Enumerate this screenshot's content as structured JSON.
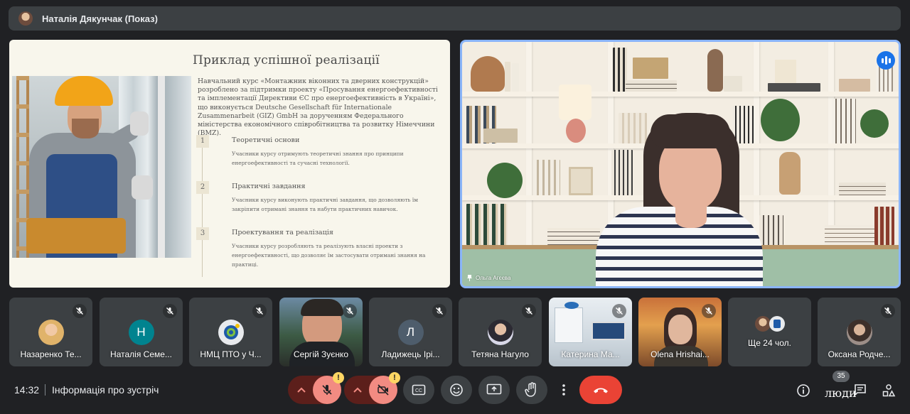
{
  "presenter": {
    "name": "Наталія Дякунчак (Показ)"
  },
  "slide": {
    "title": "Приклад успішної реалізації",
    "intro": "Навчальний курс «Монтажник віконних та дверних конструкцій» розроблено за підтримки проекту «Просування енергоефективності та імплементації Директиви ЄС про енергоефективність в Україні», що виконується Deutsche Gesellschaft für Internationale Zusammenarbeit (GIZ) GmbH за дорученням Федерального міністерства економічного співробітництва та розвитку Німеччини (BMZ).",
    "steps": [
      {
        "num": "1",
        "title": "Теоретичні основи",
        "desc": "Учасники курсу отримують теоретичні знання про принципи енергоефективності та сучасні технології."
      },
      {
        "num": "2",
        "title": "Практичні завдання",
        "desc": "Учасники курсу виконують практичні завдання, що дозволяють їм закріпити отримані знання та набути практичних навичок."
      },
      {
        "num": "3",
        "title": "Проектування та реалізація",
        "desc": "Учасники курсу розробляють та реалізують власні проекти з енергоефективності, що дозволяє їм застосувати отримані знання на практиці."
      }
    ]
  },
  "speaker": {
    "name": "Ольга Агєєва"
  },
  "participants": [
    {
      "name": "Назаренко Те...",
      "avatar_type": "photo",
      "avatar_color": "#e0b36a"
    },
    {
      "name": "Наталія Семе...",
      "avatar_type": "letter",
      "letter": "Н",
      "avatar_color": "#00838f"
    },
    {
      "name": "НМЦ ПТО у Ч...",
      "avatar_type": "logo",
      "avatar_color": "#1e5aa8"
    },
    {
      "name": "Сергій Зуєнко",
      "avatar_type": "video"
    },
    {
      "name": "Ладижець Ірі...",
      "avatar_type": "letter",
      "letter": "Л",
      "avatar_color": "#4e5d6c"
    },
    {
      "name": "Тетяна Нагуло",
      "avatar_type": "photo",
      "avatar_color": "#5d4a57"
    },
    {
      "name": "Катерина Ма...",
      "avatar_type": "video"
    },
    {
      "name": "Olena Hrishai...",
      "avatar_type": "video"
    },
    {
      "name": "Ще 24 чол.",
      "avatar_type": "group"
    },
    {
      "name": "Оксана Родче...",
      "avatar_type": "photo",
      "avatar_color": "#6b5b55"
    }
  ],
  "footer": {
    "time": "14:32",
    "meeting_info": "Інформація про зустріч",
    "people_label": "люди",
    "people_count": "35",
    "mic_warning": "!",
    "cam_warning": "!"
  },
  "colors": {
    "background": "#202124",
    "tile": "#3c4043",
    "hangup": "#ea4335",
    "muted": "#f28b82",
    "active_speaker": "#8ab4f8"
  }
}
